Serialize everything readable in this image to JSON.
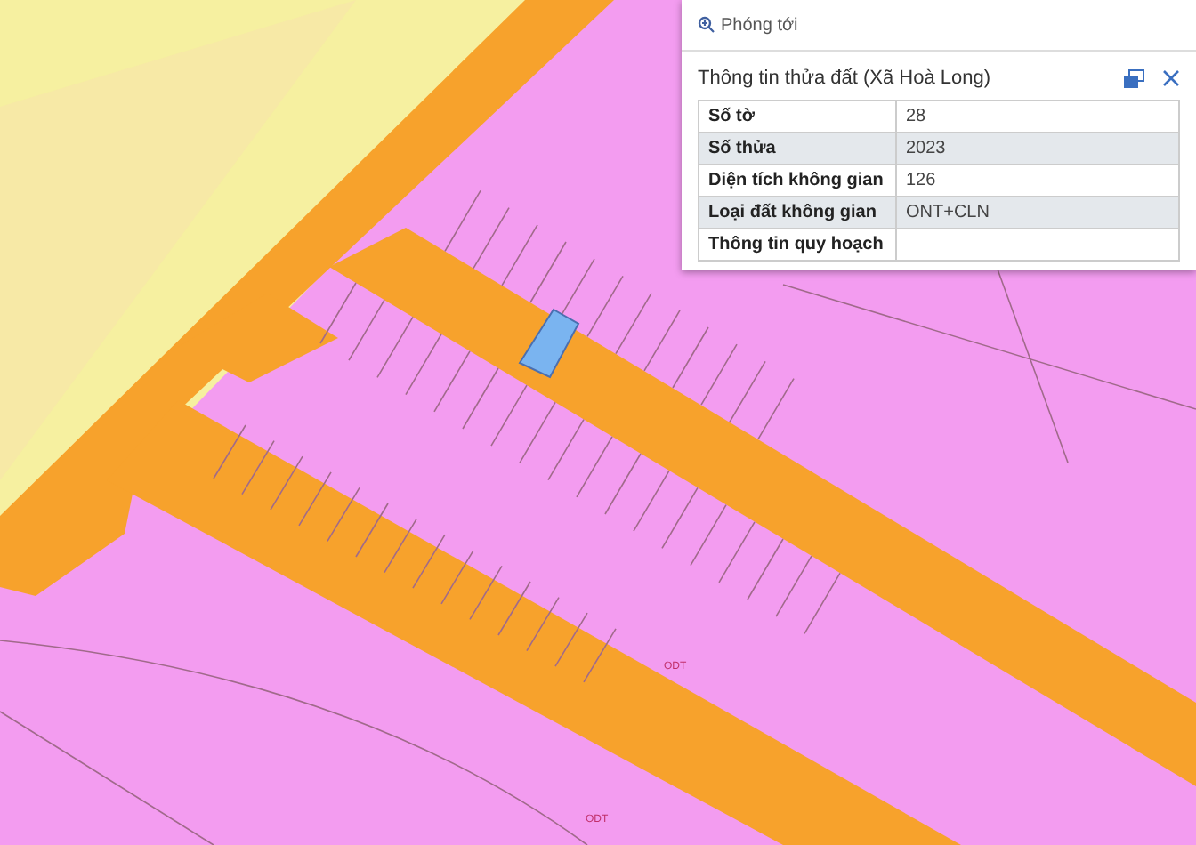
{
  "zoom_link": "Phóng tới",
  "panel": {
    "title": "Thông tin thửa đất (Xã Hoà Long)",
    "rows": [
      {
        "label": "Số tờ",
        "value": "28"
      },
      {
        "label": "Số thửa",
        "value": "2023"
      },
      {
        "label": "Diện tích không gian",
        "value": "126"
      },
      {
        "label": "Loại đất không gian",
        "value": "ONT+CLN"
      },
      {
        "label": "Thông tin quy hoạch"
      }
    ]
  },
  "map_labels": [
    "ODT",
    "ODT"
  ]
}
